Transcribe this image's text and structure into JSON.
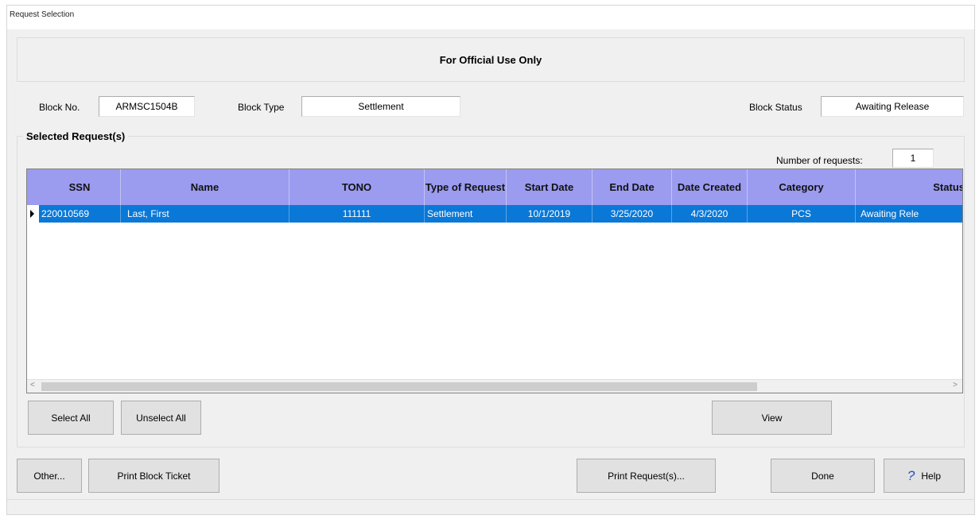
{
  "window": {
    "title": "Request Selection"
  },
  "banner": {
    "text": "For Official Use Only"
  },
  "block": {
    "no_label": "Block No.",
    "no_value": "ARMSC1504B",
    "type_label": "Block Type",
    "type_value": "Settlement",
    "status_label": "Block Status",
    "status_value": "Awaiting Release"
  },
  "selected": {
    "title": "Selected Request(s)",
    "count_label": "Number of requests:",
    "count_value": "1"
  },
  "grid": {
    "columns": [
      "SSN",
      "Name",
      "TONO",
      "Type of Request",
      "Start Date",
      "End Date",
      "Date Created",
      "Category",
      "Status"
    ],
    "rows": [
      [
        "220010569",
        "Last, First",
        "111111",
        "Settlement",
        "10/1/2019",
        "3/25/2020",
        "4/3/2020",
        "PCS",
        "Awaiting Rele"
      ]
    ],
    "selected_row_color": "#0a78d7",
    "header_color": "#9b9bf0"
  },
  "buttons": {
    "select_all": "Select All",
    "unselect_all": "Unselect All",
    "view": "View",
    "other": "Other...",
    "print_block_ticket": "Print Block Ticket",
    "print_requests": "Print Request(s)...",
    "done": "Done",
    "help": "Help"
  }
}
